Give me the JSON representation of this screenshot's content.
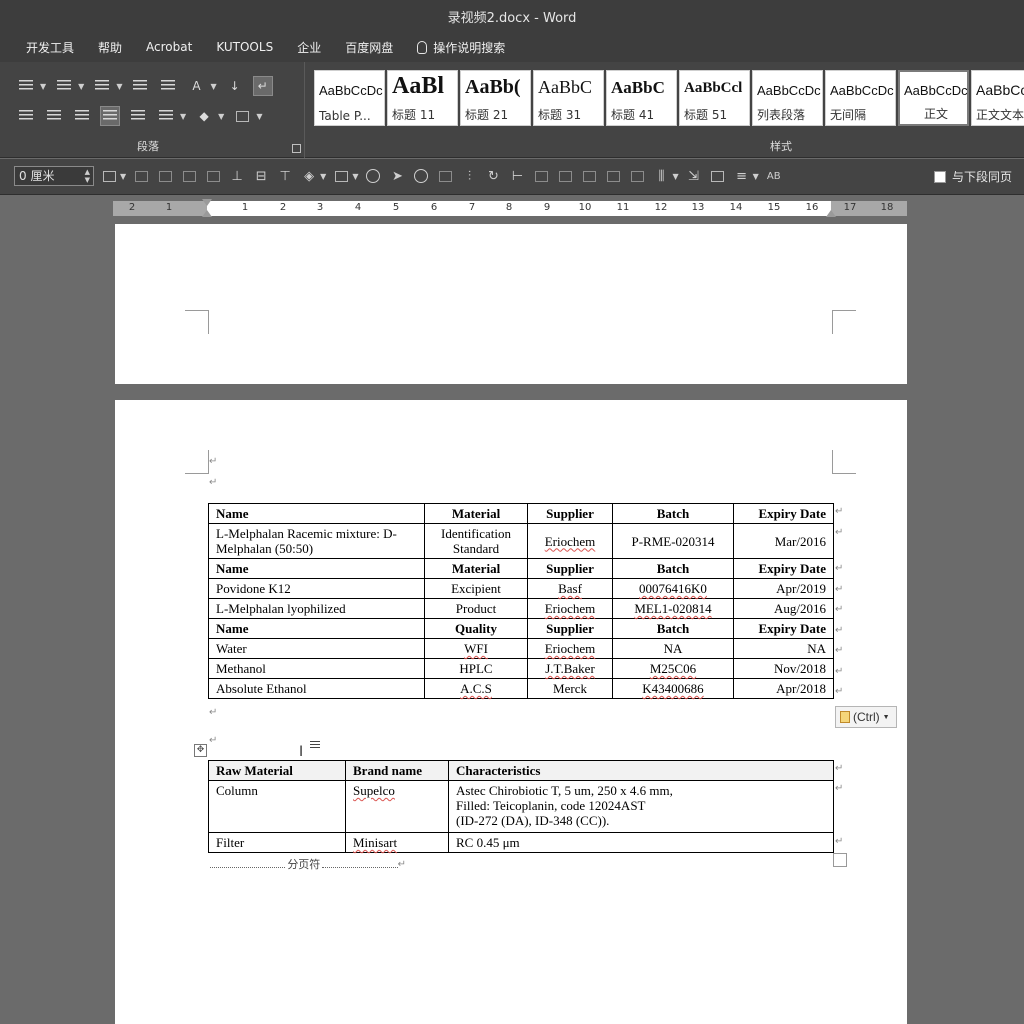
{
  "window": {
    "title": "录视频2.docx  -  Word"
  },
  "menu": [
    {
      "label": "开发工具"
    },
    {
      "label": "帮助"
    },
    {
      "label": "Acrobat"
    },
    {
      "label": "KUTOOLS"
    },
    {
      "label": "企业"
    },
    {
      "label": "百度网盘"
    },
    {
      "label": "操作说明搜索"
    }
  ],
  "ribbon": {
    "paragraph_group_label": "段落",
    "styles_group_label": "样式",
    "styles": [
      {
        "sample": "AaBbCcDc",
        "name": "Table P..."
      },
      {
        "sample": "AaBl",
        "name": "标题 11"
      },
      {
        "sample": "AaBb(",
        "name": "标题 21"
      },
      {
        "sample": "AaBbC",
        "name": "标题 31"
      },
      {
        "sample": "AaBbC",
        "name": "标题 41"
      },
      {
        "sample": "AaBbCcl",
        "name": "标题 51"
      },
      {
        "sample": "AaBbCcDc",
        "name": "列表段落"
      },
      {
        "sample": "AaBbCcDc",
        "name": "无间隔"
      },
      {
        "sample": "AaBbCcDc",
        "name": "正文"
      },
      {
        "sample": "AaBbCc",
        "name": "正文文本"
      }
    ],
    "active_style": "正文"
  },
  "draw_toolbar": {
    "size_value": "0 厘米",
    "same_page_label": "与下段同页",
    "ab_label": "AB"
  },
  "ruler": {
    "numbers": [
      "2",
      "1",
      "",
      "1",
      "2",
      "3",
      "4",
      "5",
      "6",
      "7",
      "8",
      "9",
      "10",
      "11",
      "12",
      "13",
      "14",
      "15",
      "16",
      "17",
      "18"
    ]
  },
  "table1": {
    "rows": [
      {
        "type": "header",
        "cells": [
          "Name",
          "Material",
          "Supplier",
          "Batch",
          "Expiry Date"
        ]
      },
      {
        "type": "data",
        "cells": [
          "L-Melphalan Racemic mixture: D-Melphalan (50:50)",
          "Identification Standard",
          "Eriochem",
          "P-RME-020314",
          "Mar/2016"
        ]
      },
      {
        "type": "header",
        "cells": [
          "Name",
          "Material",
          "Supplier",
          "Batch",
          "Expiry Date"
        ]
      },
      {
        "type": "data",
        "cells": [
          "Povidone K12",
          "Excipient",
          "Basf",
          "00076416K0",
          "Apr/2019"
        ]
      },
      {
        "type": "data",
        "cells": [
          "L-Melphalan lyophilized",
          "Product",
          "Eriochem",
          "MEL1-020814",
          "Aug/2016"
        ]
      },
      {
        "type": "header",
        "cells": [
          "Name",
          "Quality",
          "Supplier",
          "Batch",
          "Expiry Date"
        ]
      },
      {
        "type": "data",
        "cells": [
          "Water",
          "WFI",
          "Eriochem",
          "NA",
          "NA"
        ]
      },
      {
        "type": "data",
        "cells": [
          "Methanol",
          "HPLC",
          "J.T.Baker",
          "M25C06",
          "Nov/2018"
        ]
      },
      {
        "type": "data",
        "cells": [
          "Absolute Ethanol",
          "A.C.S",
          "Merck",
          "K43400686",
          "Apr/2018"
        ]
      }
    ]
  },
  "paste_options": {
    "label": "(Ctrl)"
  },
  "table2": {
    "header": [
      "Raw Material",
      "Brand name",
      "Characteristics"
    ],
    "rows": [
      {
        "cells": [
          "Column",
          "Supelco",
          "Astec Chirobiotic T, 5 um, 250 x 4.6 mm,\nFilled: Teicoplanin, code 12024AST\n(ID-272 (DA), ID-348 (CC))."
        ]
      },
      {
        "cells": [
          "Filter",
          "Minisart",
          "RC 0.45 μm"
        ]
      }
    ]
  },
  "page_break_label": "分页符"
}
